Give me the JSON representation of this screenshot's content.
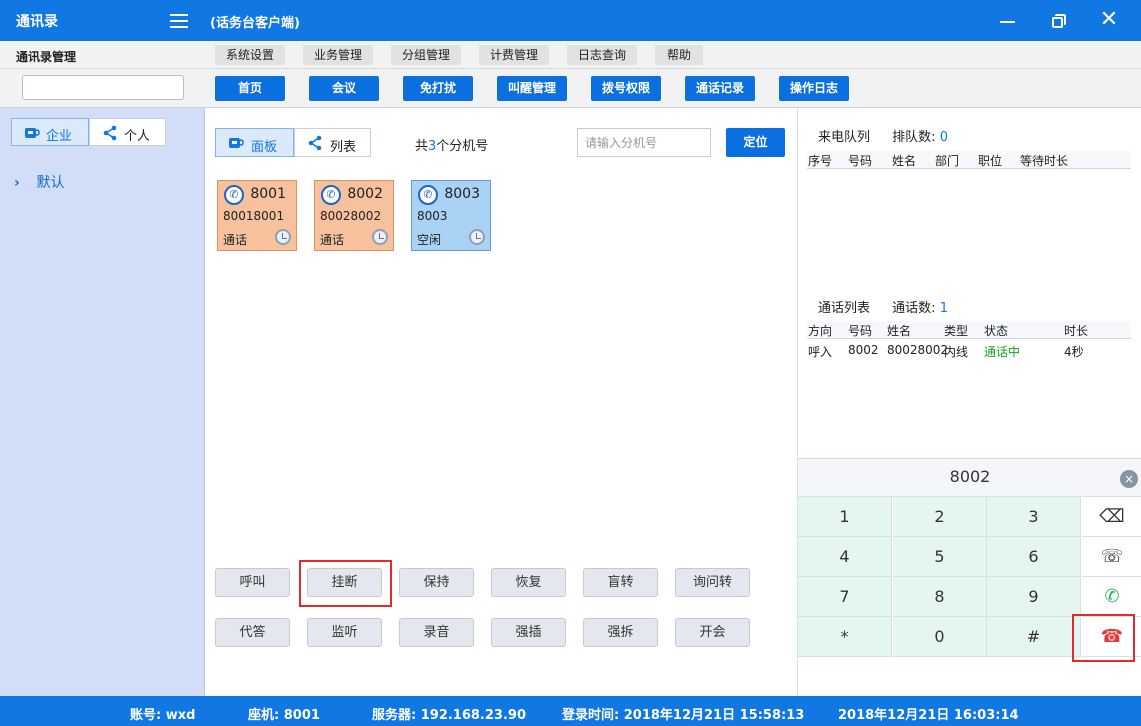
{
  "window": {
    "app_title": "通讯录",
    "subtitle": "(话务台客户端)",
    "minimize_glyph": "",
    "close_glyph": "✕"
  },
  "sidebar": {
    "header": "通讯录管理",
    "search_value": "",
    "tabs": [
      {
        "label": "企业",
        "icon": "cup-icon"
      },
      {
        "label": "个人",
        "icon": "share-icon"
      }
    ],
    "tree": [
      {
        "label": "默认",
        "arrow": "›"
      }
    ]
  },
  "menubar": {
    "items": [
      "系统设置",
      "业务管理",
      "分组管理",
      "计费管理",
      "日志查询",
      "帮助"
    ]
  },
  "toolbar": {
    "buttons": [
      "首页",
      "会议",
      "免打扰",
      "叫醒管理",
      "拨号权限",
      "通话记录",
      "操作日志"
    ]
  },
  "center": {
    "views": [
      {
        "label": "面板",
        "icon": "cup-icon"
      },
      {
        "label": "列表",
        "icon": "share-icon"
      }
    ],
    "count_prefix": "共",
    "count_value": "3",
    "count_suffix": "个分机号",
    "search_placeholder": "请输入分机号",
    "locate_label": "定位",
    "extensions": [
      {
        "ext": "8001",
        "number": "80018001",
        "status": "通话",
        "state": "busy"
      },
      {
        "ext": "8002",
        "number": "80028002",
        "status": "通话",
        "state": "busy"
      },
      {
        "ext": "8003",
        "number": "8003",
        "status": "空闲",
        "state": "idle"
      }
    ],
    "actions_row1": [
      "呼叫",
      "挂断",
      "保持",
      "恢复",
      "盲转",
      "询问转"
    ],
    "actions_row2": [
      "代答",
      "监听",
      "录音",
      "强插",
      "强拆",
      "开会"
    ]
  },
  "queue": {
    "title": "来电队列",
    "count_label": "排队数:",
    "count": "0",
    "columns": [
      "序号",
      "号码",
      "姓名",
      "部门",
      "职位",
      "等待时长"
    ]
  },
  "calls": {
    "title": "通话列表",
    "count_label": "通话数:",
    "count": "1",
    "columns": [
      "方向",
      "号码",
      "姓名",
      "类型",
      "状态",
      "时长"
    ],
    "rows": [
      {
        "direction": "呼入",
        "number": "8002",
        "name": "80028002",
        "type": "内线",
        "status": "通话中",
        "duration": "4秒"
      }
    ],
    "status_color": "#17a317"
  },
  "dialpad": {
    "display": "8002",
    "clear_glyph": "×",
    "keys": [
      "1",
      "2",
      "3",
      "4",
      "5",
      "6",
      "7",
      "8",
      "9",
      "*",
      "0",
      "#"
    ],
    "functions": [
      {
        "name": "backspace-icon",
        "glyph": "⌫"
      },
      {
        "name": "transfer-call-icon",
        "glyph": "☏"
      },
      {
        "name": "answer-call-icon",
        "glyph": "✆"
      },
      {
        "name": "hangup-icon",
        "glyph": "☎"
      }
    ]
  },
  "statusbar": {
    "account": "账号: wxd",
    "seat": "座机: 8001",
    "server": "服务器: 192.168.23.90",
    "login": "登录时间: 2018年12月21日 15:58:13",
    "now": "2018年12月21日 16:03:14"
  },
  "colors": {
    "primary": "#1077e3",
    "highlight": "#e22b2b",
    "busy": "#f8c19d",
    "idle": "#a9d2f5"
  }
}
